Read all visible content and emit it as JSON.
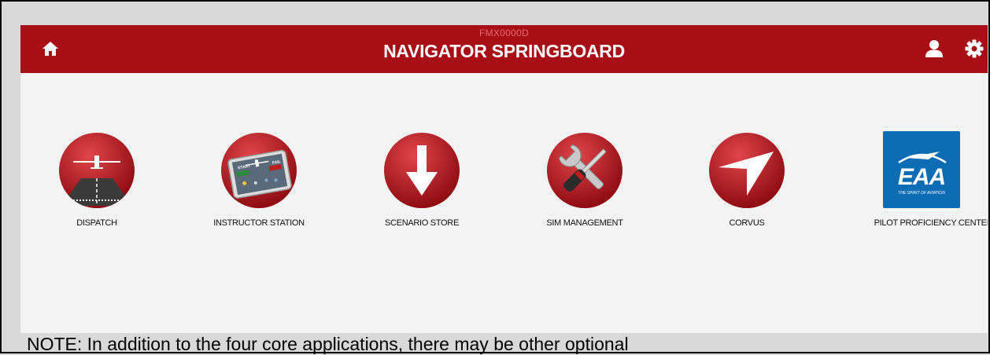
{
  "header": {
    "code": "FMX0000D",
    "title": "NAVIGATOR SPRINGBOARD",
    "icons": {
      "home": "home-icon",
      "user": "user-icon",
      "settings": "gear-icon"
    }
  },
  "apps": [
    {
      "label": "DISPATCH",
      "icon": "airplane-runway-icon"
    },
    {
      "label": "INSTRUCTOR STATION",
      "icon": "tablet-instructor-icon",
      "badges": {
        "start": "START",
        "fail": "FAIL"
      }
    },
    {
      "label": "SCENARIO STORE",
      "icon": "download-arrow-icon"
    },
    {
      "label": "SIM MANAGEMENT",
      "icon": "wrench-screwdriver-icon"
    },
    {
      "label": "CORVUS",
      "icon": "navigation-arrow-icon"
    },
    {
      "label": "PILOT PROFICIENCY CENTER",
      "icon": "eaa-logo-icon",
      "logo_text": "EAA",
      "logo_tagline": "THE SPIRIT OF AVIATION"
    }
  ],
  "note": "NOTE: In addition to the four core applications, there may be other optional",
  "colors": {
    "header": "#a70e16",
    "background": "#f3f3f3",
    "eaa_blue": "#0c6cb4"
  }
}
